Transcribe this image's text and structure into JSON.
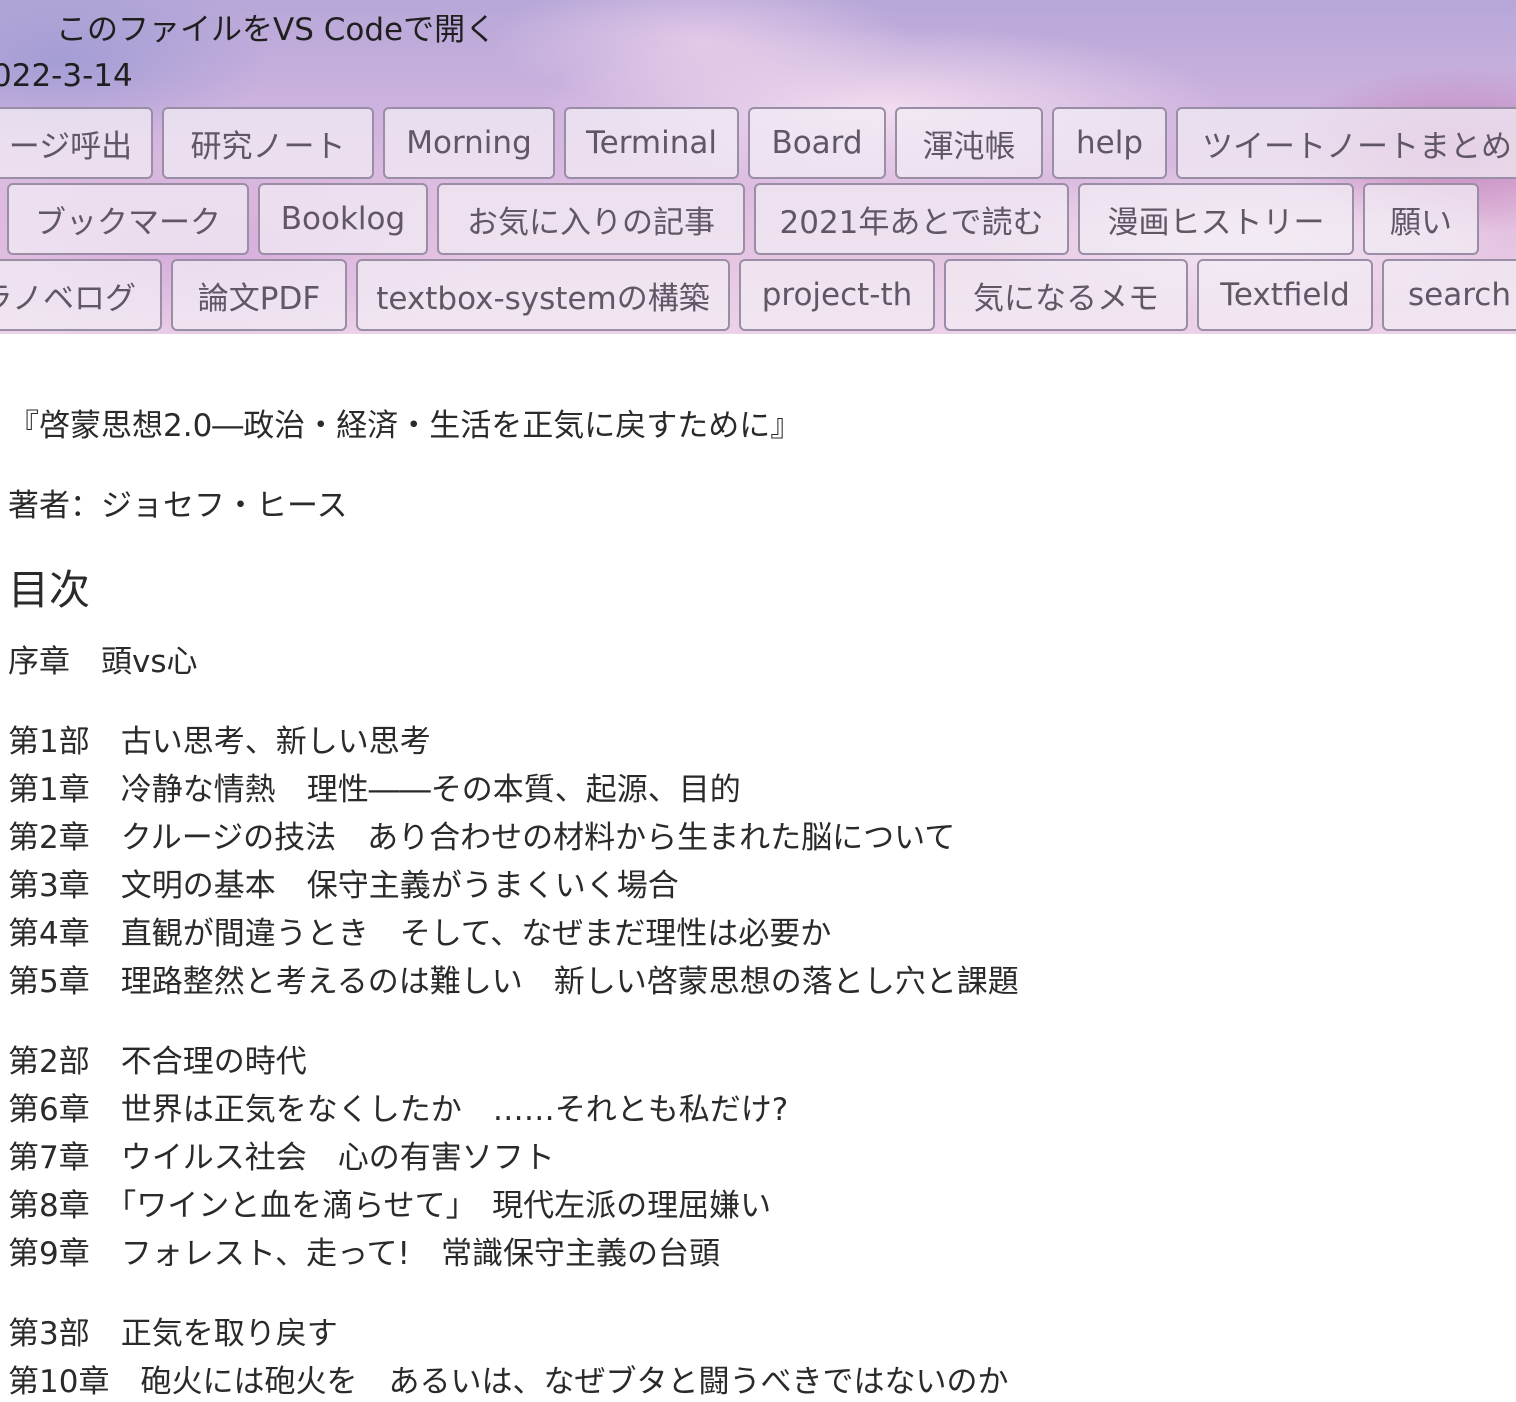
{
  "header": {
    "open_vscode": "このファイルをVS Codeで開く",
    "date": "022-3-14"
  },
  "nav": {
    "row1": [
      "ージ呼出",
      "研究ノート",
      "Morning",
      "Terminal",
      "Board",
      "渾沌帳",
      "help",
      "ツイートノートまとめ"
    ],
    "row2": [
      "ブックマーク",
      "Booklog",
      "お気に入りの記事",
      "2021年あとで読む",
      "漫画ヒストリー",
      "願い"
    ],
    "row3": [
      "ラノベログ",
      "論文PDF",
      "textbox-systemの構築",
      "project-th",
      "気になるメモ",
      "Textfield",
      "search"
    ]
  },
  "content": {
    "book_title": "『啓蒙思想2.0―政治・経済・生活を正気に戻すために』",
    "author": "著者：ジョセフ・ヒース",
    "toc_heading": "目次",
    "toc": [
      "序章　頭vs心",
      "第1部　古い思考、新しい思考",
      "第1章　冷静な情熱　理性――その本質、起源、目的",
      "第2章　クルージの技法　あり合わせの材料から生まれた脳について",
      "第3章　文明の基本　保守主義がうまくいく場合",
      "第4章　直観が間違うとき　そして、なぜまだ理性は必要か",
      "第5章　理路整然と考えるのは難しい　新しい啓蒙思想の落とし穴と課題",
      "第2部　不合理の時代",
      "第6章　世界は正気をなくしたか　……それとも私だけ?",
      "第7章　ウイルス社会　心の有害ソフト",
      "第8章　「ワインと血を滴らせて」　現代左派の理屈嫌い",
      "第9章　フォレスト、走って!　常識保守主義の台頭",
      "第3部　正気を取り戻す",
      "第10章　砲火には砲火を　あるいは、なぜブタと闘うべきではないのか"
    ]
  }
}
